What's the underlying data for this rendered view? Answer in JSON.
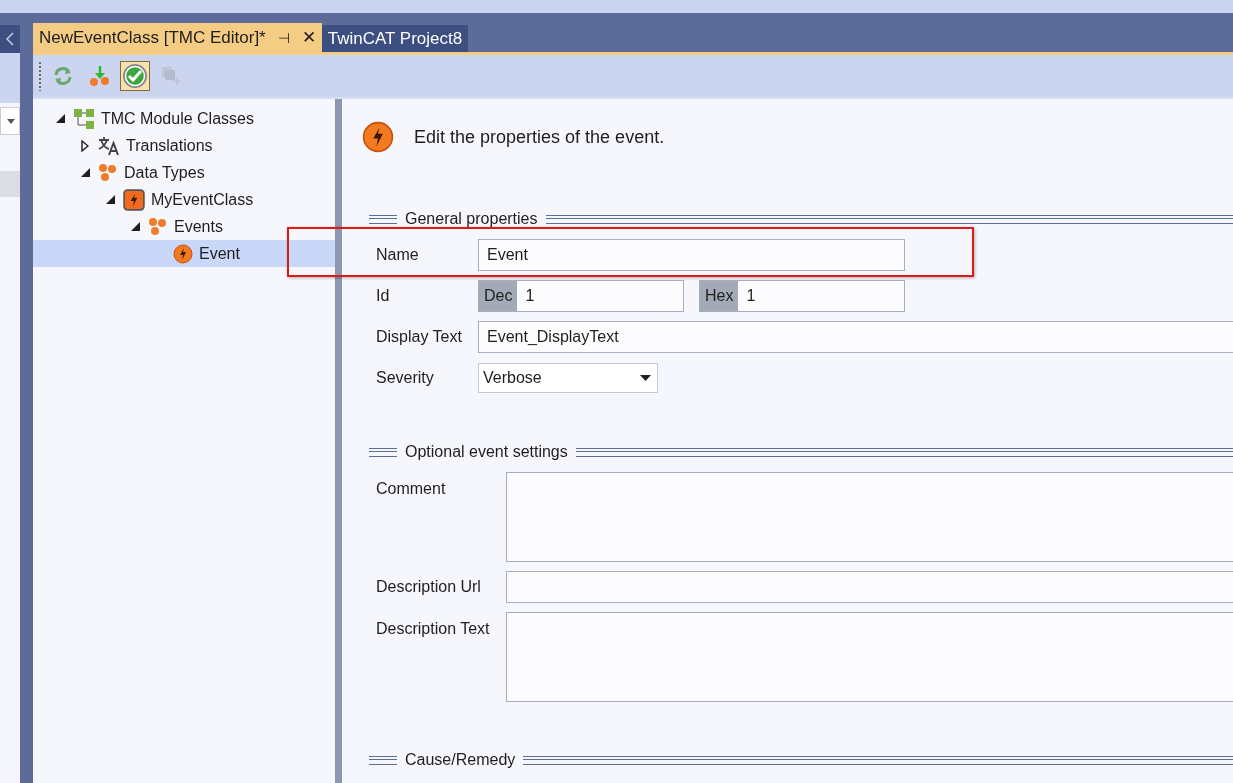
{
  "tabs": [
    {
      "label": "NewEventClass [TMC Editor]*",
      "selected": true,
      "pin": "⊣",
      "close": "✕"
    },
    {
      "label": "TwinCAT Project8",
      "selected": false
    }
  ],
  "toolbar": [
    {
      "kind": "reload",
      "selected": false,
      "disabled": false
    },
    {
      "kind": "download",
      "selected": false,
      "disabled": false
    },
    {
      "kind": "check",
      "selected": true,
      "disabled": false
    },
    {
      "kind": "add",
      "selected": false,
      "disabled": true
    }
  ],
  "tree": [
    {
      "label": "TMC Module Classes",
      "kind": "classes",
      "expanded": true,
      "selected": false,
      "children": [
        {
          "label": "Translations",
          "kind": "translation",
          "expanded": false,
          "selected": false
        },
        {
          "label": "Data Types",
          "kind": "types",
          "expanded": true,
          "selected": false,
          "children": [
            {
              "label": "MyEventClass",
              "kind": "eventclass",
              "expanded": true,
              "selected": false,
              "children": [
                {
                  "label": "Events",
                  "kind": "types",
                  "expanded": true,
                  "selected": false,
                  "children": [
                    {
                      "label": "Event",
                      "kind": "event",
                      "selected": true
                    }
                  ]
                }
              ]
            }
          ]
        }
      ]
    }
  ],
  "header": "Edit the properties of the event.",
  "sections": [
    {
      "title": "General properties",
      "fields": [
        {
          "kind": "short_text",
          "label": "Name",
          "value": "Event",
          "highlighted": true
        },
        {
          "kind": "id",
          "label": "Id",
          "dec_label": "Dec",
          "dec_value": "1",
          "hex_label": "Hex",
          "hex_value": "1"
        },
        {
          "kind": "text",
          "label": "Display Text",
          "value": "Event_DisplayText"
        },
        {
          "kind": "dropdown",
          "label": "Severity",
          "value": "Verbose"
        }
      ]
    },
    {
      "title": "Optional event settings",
      "fields": [
        {
          "kind": "textarea",
          "label": "Comment"
        },
        {
          "kind": "text",
          "label": "Description Url"
        },
        {
          "kind": "textarea",
          "label": "Description Text"
        }
      ]
    },
    {
      "title": "Cause/Remedy"
    }
  ]
}
